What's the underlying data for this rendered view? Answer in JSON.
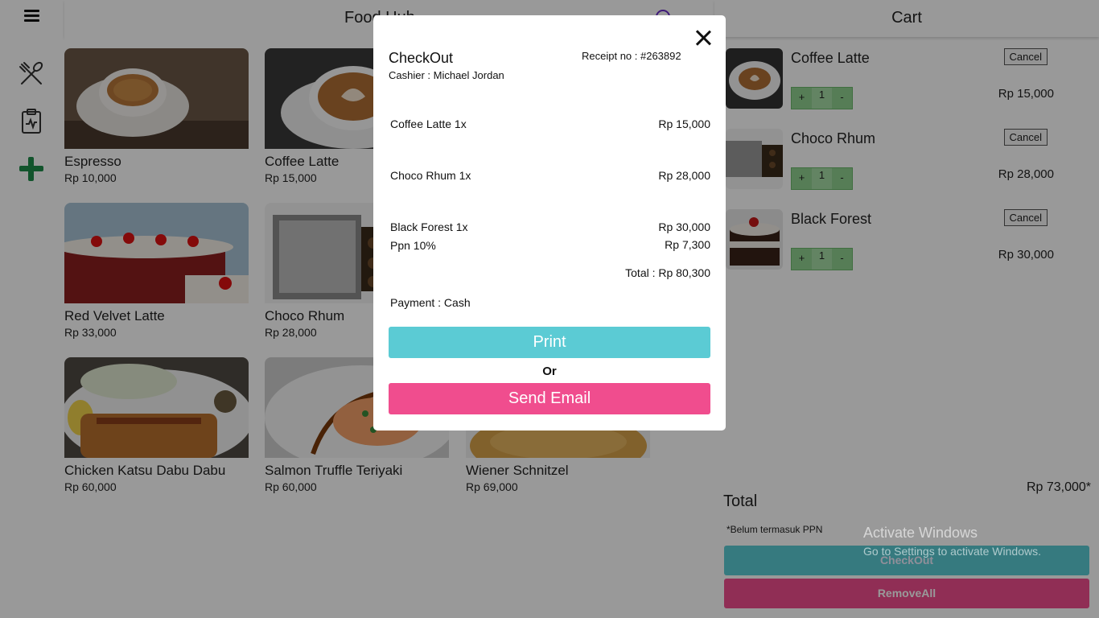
{
  "header": {
    "title": "Food Hub"
  },
  "menu": {
    "items": [
      {
        "name": "Espresso",
        "price": "Rp 10,000"
      },
      {
        "name": "Coffee Latte",
        "price": "Rp 15,000"
      },
      {
        "name": "Red Velvet Latte",
        "price": "Rp 33,000"
      },
      {
        "name": "Choco Rhum",
        "price": "Rp 28,000"
      },
      {
        "name": "Chicken Katsu Dabu Dabu",
        "price": "Rp 60,000"
      },
      {
        "name": "Salmon Truffle Teriyaki",
        "price": "Rp 60,000"
      },
      {
        "name": "Wiener Schnitzel",
        "price": "Rp 69,000"
      }
    ]
  },
  "cart": {
    "title": "Cart",
    "items": [
      {
        "name": "Coffee Latte",
        "qty": "1",
        "price": "Rp 15,000",
        "cancel": "Cancel",
        "plus": "+",
        "minus": "-"
      },
      {
        "name": "Choco Rhum",
        "qty": "1",
        "price": "Rp 28,000",
        "cancel": "Cancel",
        "plus": "+",
        "minus": "-"
      },
      {
        "name": "Black Forest",
        "qty": "1",
        "price": "Rp 30,000",
        "cancel": "Cancel",
        "plus": "+",
        "minus": "-"
      }
    ],
    "total_label": "Total",
    "total_value": "Rp 73,000*",
    "ppn_note": "*Belum termasuk PPN",
    "checkout_label": "CheckOut",
    "removeall_label": "RemoveAll"
  },
  "modal": {
    "title": "CheckOut",
    "cashier": "Cashier : Michael Jordan",
    "receipt": "Receipt no : #263892",
    "lines": [
      {
        "label": "Coffee Latte 1x",
        "value": "Rp 15,000"
      },
      {
        "label": "Choco Rhum 1x",
        "value": "Rp 28,000"
      },
      {
        "label": "Black Forest 1x",
        "value": "Rp 30,000"
      },
      {
        "label": "Ppn 10%",
        "value": "Rp 7,300"
      }
    ],
    "total": "Total : Rp 80,300",
    "payment": "Payment : Cash",
    "print_label": "Print",
    "or_label": "Or",
    "email_label": "Send Email"
  },
  "watermark": {
    "line1": "Activate Windows",
    "line2": "Go to Settings to activate Windows."
  },
  "colors": {
    "print": "#5bcbd4",
    "email": "#f04d8e",
    "stepper": "#8fd18f",
    "plus_icon": "#1f8c4a",
    "search_icon": "#6a2cc9"
  }
}
